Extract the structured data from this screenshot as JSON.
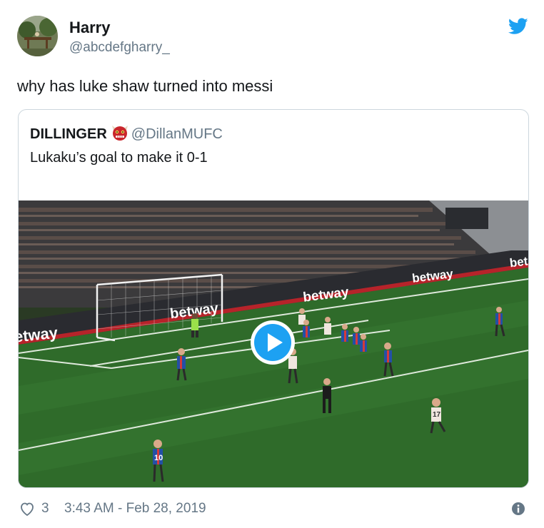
{
  "tweet": {
    "display_name": "Harry",
    "handle": "@abcdefgharry_",
    "text": "why has luke shaw turned into messi",
    "likes": "3",
    "timestamp": "3:43 AM - Feb 28, 2019"
  },
  "quoted_tweet": {
    "display_name": "DILLINGER",
    "handle": "@DillanMUFC",
    "text": "Lukaku’s goal to make it 0-1",
    "emoji_icon": "ogre-emoji-icon"
  },
  "video": {
    "board_text": "betway",
    "board_text_partial": "bet",
    "board_text_left": "etway",
    "player_number_left": "10",
    "player_number_right": "17"
  },
  "colors": {
    "twitter_blue": "#1da1f2",
    "text_primary": "#14171a",
    "text_secondary": "#657786",
    "border": "#ccd6dd",
    "pitch_green": "#2f6b2a"
  }
}
